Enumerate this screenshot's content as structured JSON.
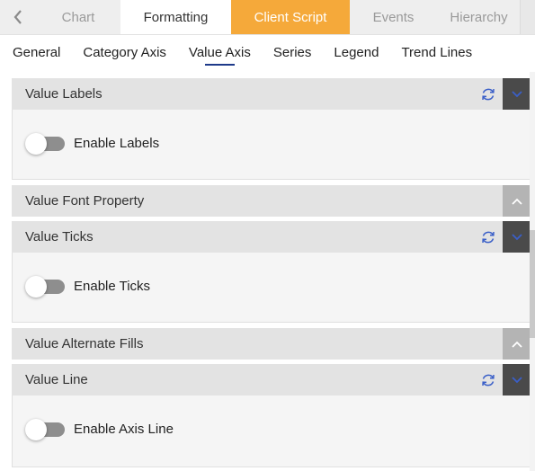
{
  "top_tabs": [
    {
      "label": "Chart"
    },
    {
      "label": "Formatting"
    },
    {
      "label": "Client Script"
    },
    {
      "label": "Events"
    },
    {
      "label": "Hierarchy"
    }
  ],
  "sub_tabs": [
    {
      "label": "General"
    },
    {
      "label": "Category Axis"
    },
    {
      "label": "Value Axis"
    },
    {
      "label": "Series"
    },
    {
      "label": "Legend"
    },
    {
      "label": "Trend Lines"
    }
  ],
  "active_sub_tab": "Value Axis",
  "panels": [
    {
      "title": "Value Labels",
      "expanded": true,
      "toggle_label": "Enable Labels",
      "enabled": false
    },
    {
      "title": "Value Font Property",
      "expanded": false
    },
    {
      "title": "Value Ticks",
      "expanded": true,
      "toggle_label": "Enable Ticks",
      "enabled": false
    },
    {
      "title": "Value Alternate Fills",
      "expanded": false
    },
    {
      "title": "Value Line",
      "expanded": true,
      "toggle_label": "Enable Axis Line",
      "enabled": false
    }
  ],
  "colors": {
    "accent_tab": "#f5a93a",
    "refresh_icon": "#3a5fc8",
    "header_bg": "#e3e3e3",
    "collapse_dark": "#4a4a4a",
    "expand_light": "#b4b4b4"
  },
  "icons": {
    "back": "chevron-left-icon",
    "refresh": "refresh-icon",
    "collapse": "chevron-down-icon",
    "expand": "chevron-up-icon"
  }
}
